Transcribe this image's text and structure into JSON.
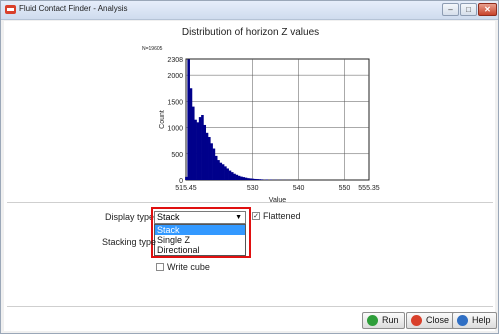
{
  "window": {
    "title": "Fluid Contact Finder - Analysis",
    "controls": [
      "minimize-icon",
      "maximize-icon",
      "close-icon"
    ]
  },
  "chart_data": {
    "type": "bar",
    "title": "Distribution of horizon Z values",
    "xlabel": "Value",
    "ylabel": "Count",
    "annotation": "N=19605",
    "xlim": [
      515.45,
      555.35
    ],
    "ylim": [
      0,
      2308
    ],
    "x_ticks": [
      "515.45",
      "530",
      "540",
      "550",
      "555.35"
    ],
    "y_ticks": [
      "0",
      "500",
      "1000",
      "1500",
      "2000",
      "2308"
    ],
    "bar_color": "#00008b",
    "x": [
      515.5,
      516,
      516.5,
      517,
      517.5,
      518,
      518.5,
      519,
      519.5,
      520,
      520.5,
      521,
      521.5,
      522,
      522.5,
      523,
      523.5,
      524,
      524.5,
      525,
      525.5,
      526,
      526.5,
      527,
      527.5,
      528,
      528.5,
      529,
      529.5,
      530,
      530.5,
      531,
      531.5,
      532,
      533,
      534,
      535,
      536,
      537,
      538
    ],
    "values": [
      60,
      2300,
      1750,
      1400,
      1150,
      1100,
      1200,
      1240,
      1050,
      900,
      820,
      700,
      600,
      460,
      380,
      330,
      300,
      260,
      220,
      180,
      150,
      120,
      100,
      80,
      65,
      55,
      45,
      35,
      30,
      25,
      20,
      18,
      15,
      12,
      10,
      8,
      6,
      5,
      4,
      3
    ]
  },
  "form": {
    "display_type_label": "Display type",
    "display_type_value": "Stack",
    "display_type_options": [
      "Stack",
      "Single Z",
      "Directional"
    ],
    "flattened_label": "Flattened",
    "flattened_checked": true,
    "stacking_type_label": "Stacking type",
    "write_cube_label": "Write cube",
    "write_cube_checked": false
  },
  "buttons": {
    "run": "Run",
    "close": "Close",
    "help": "Help"
  },
  "colors": {
    "accent_highlight": "#e01010",
    "selection": "#3399ff",
    "run_icon": "#2e9e3a",
    "close_icon": "#d9402b",
    "help_icon": "#2f6fc4"
  }
}
